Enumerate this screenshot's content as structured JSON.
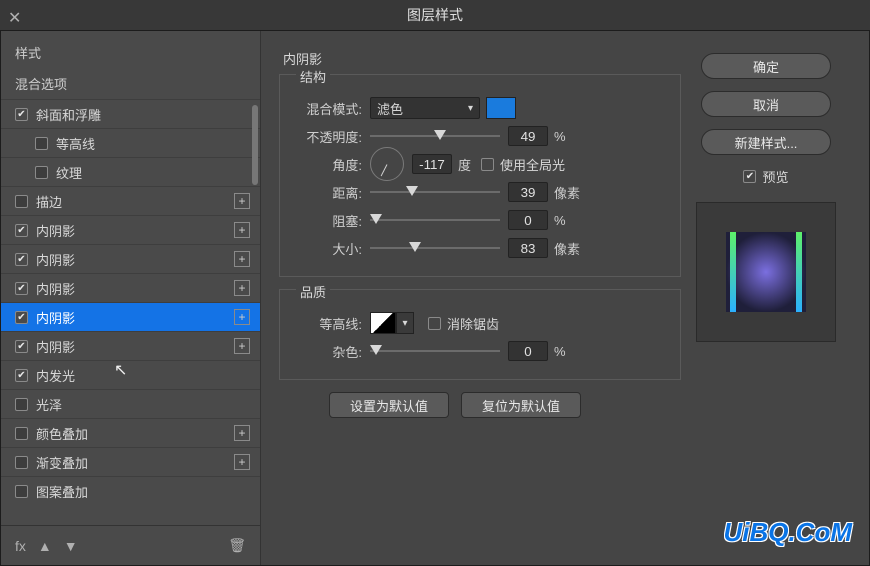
{
  "dialog": {
    "title": "图层样式",
    "watermark": "UiBQ.CoM"
  },
  "sidebar": {
    "styles_label": "样式",
    "blending_label": "混合选项",
    "items": [
      {
        "label": "斜面和浮雕",
        "checked": true,
        "has_plus": false,
        "sub": false
      },
      {
        "label": "等高线",
        "checked": false,
        "has_plus": false,
        "sub": true
      },
      {
        "label": "纹理",
        "checked": false,
        "has_plus": false,
        "sub": true
      },
      {
        "label": "描边",
        "checked": false,
        "has_plus": true,
        "sub": false
      },
      {
        "label": "内阴影",
        "checked": true,
        "has_plus": true,
        "sub": false
      },
      {
        "label": "内阴影",
        "checked": true,
        "has_plus": true,
        "sub": false
      },
      {
        "label": "内阴影",
        "checked": true,
        "has_plus": true,
        "sub": false
      },
      {
        "label": "内阴影",
        "checked": true,
        "has_plus": true,
        "sub": false,
        "selected": true
      },
      {
        "label": "内阴影",
        "checked": true,
        "has_plus": true,
        "sub": false
      },
      {
        "label": "内发光",
        "checked": true,
        "has_plus": false,
        "sub": false
      },
      {
        "label": "光泽",
        "checked": false,
        "has_plus": false,
        "sub": false
      },
      {
        "label": "颜色叠加",
        "checked": false,
        "has_plus": true,
        "sub": false
      },
      {
        "label": "渐变叠加",
        "checked": false,
        "has_plus": true,
        "sub": false
      },
      {
        "label": "图案叠加",
        "checked": false,
        "has_plus": false,
        "sub": false
      }
    ],
    "footer": {
      "fx": "fx",
      "up": "▲",
      "down": "▼",
      "trash": "🗑"
    }
  },
  "panel": {
    "title": "内阴影",
    "group_structure": "结构",
    "group_quality": "品质",
    "labels": {
      "blend_mode": "混合模式:",
      "opacity": "不透明度:",
      "angle": "角度:",
      "degree_unit": "度",
      "use_global": "使用全局光",
      "distance": "距离:",
      "choke": "阻塞:",
      "size": "大小:",
      "px_unit": "像素",
      "pct_unit": "%",
      "contour": "等高线:",
      "antialias": "消除锯齿",
      "noise": "杂色:"
    },
    "values": {
      "blend_mode": "滤色",
      "color": "#1a7bdd",
      "opacity": "49",
      "angle": "-117",
      "use_global": false,
      "distance": "39",
      "choke": "0",
      "size": "83",
      "antialias": false,
      "noise": "0"
    },
    "buttons": {
      "make_default": "设置为默认值",
      "reset_default": "复位为默认值"
    }
  },
  "right": {
    "ok": "确定",
    "cancel": "取消",
    "new_style": "新建样式...",
    "preview": "预览",
    "preview_checked": true
  }
}
